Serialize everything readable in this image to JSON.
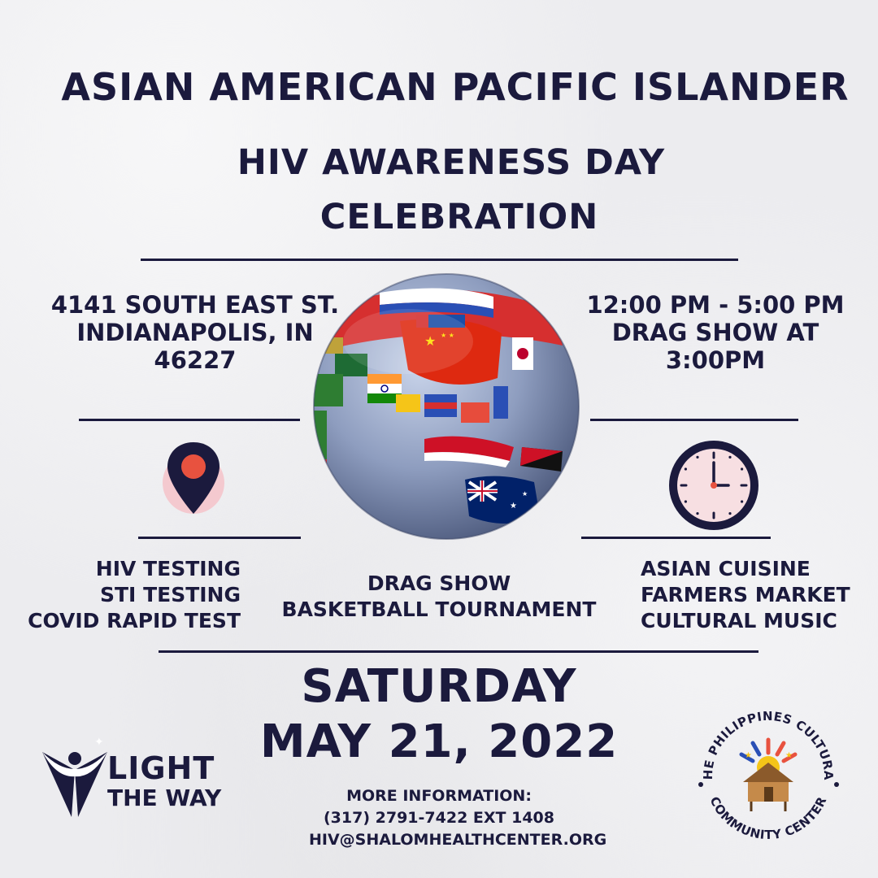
{
  "header": {
    "title_line1": "ASIAN AMERICAN PACIFIC ISLANDER",
    "title_line2": "HIV AWARENESS DAY",
    "title_line3": "CELEBRATION"
  },
  "location": {
    "line1": "4141 SOUTH EAST ST.",
    "line2": "INDIANAPOLIS, IN",
    "line3": "46227"
  },
  "time": {
    "line1": "12:00 PM - 5:00 PM",
    "line2": "DRAG SHOW AT",
    "line3": "3:00PM"
  },
  "icons": {
    "location": "map-pin-icon",
    "clock": "clock-icon",
    "globe": "globe-with-flags"
  },
  "activities": {
    "left": [
      "HIV TESTING",
      "STI TESTING",
      "COVID RAPID TEST"
    ],
    "center": [
      "DRAG SHOW",
      "BASKETBALL TOURNAMENT"
    ],
    "right": [
      "ASIAN CUISINE",
      "FARMERS MARKET",
      "CULTURAL MUSIC"
    ]
  },
  "event_date": {
    "day": "SATURDAY",
    "date": "MAY 21, 2022"
  },
  "contact": {
    "heading": "MORE INFORMATION:",
    "phone": "(317) 2791-7422 EXT 1408",
    "email": "HIV@SHALOMHEALTHCENTER.ORG"
  },
  "logos": {
    "light_the_way": {
      "line1": "LIGHT",
      "line2": "THE WAY"
    },
    "pccc": {
      "top": "THE PHILIPPINES CULTURAL",
      "bottom": "COMMUNITY CENTER"
    }
  },
  "colors": {
    "navy": "#1b1a3d",
    "pin_circle": "#f4c9cf",
    "pin_dot": "#e8523f",
    "clock_face": "#f7dfe2"
  }
}
